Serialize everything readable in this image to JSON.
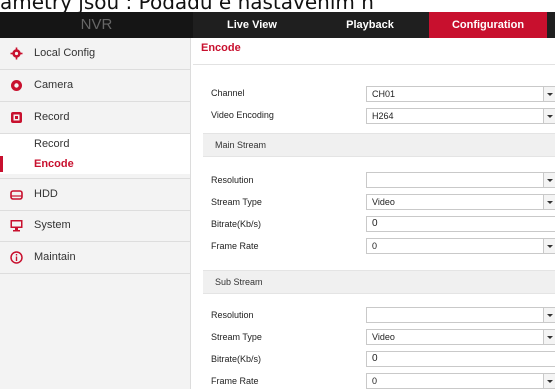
{
  "caption": "ametry jsou : Podadu e nastavenim n",
  "topbar": {
    "brand": "NVR",
    "tabs": [
      "Live View",
      "Playback",
      "Configuration"
    ],
    "active_tab": "Configuration"
  },
  "sidebar": {
    "items": [
      {
        "label": "Local Config",
        "icon": "gear-icon"
      },
      {
        "label": "Camera",
        "icon": "camera-icon"
      },
      {
        "label": "Record",
        "icon": "record-icon"
      },
      {
        "label": "HDD",
        "icon": "hdd-icon"
      },
      {
        "label": "System",
        "icon": "monitor-icon"
      },
      {
        "label": "Maintain",
        "icon": "info-icon"
      }
    ],
    "record_sub": [
      {
        "label": "Record"
      },
      {
        "label": "Encode"
      }
    ]
  },
  "content": {
    "tab": "Encode",
    "channel_label": "Channel",
    "channel_value": "CH01",
    "encoding_label": "Video Encoding",
    "encoding_value": "H264",
    "main": {
      "title": "Main Stream",
      "resolution_label": "Resolution",
      "resolution_value": "",
      "stream_type_label": "Stream Type",
      "stream_type_value": "Video",
      "bitrate_label": "Bitrate(Kb/s)",
      "bitrate_value": "0",
      "frame_rate_label": "Frame Rate",
      "frame_rate_value": "0"
    },
    "sub": {
      "title": "Sub Stream",
      "resolution_label": "Resolution",
      "resolution_value": "",
      "stream_type_label": "Stream Type",
      "stream_type_value": "Video",
      "bitrate_label": "Bitrate(Kb/s)",
      "bitrate_value": "0",
      "frame_rate_label": "Frame Rate",
      "frame_rate_value": "0"
    }
  },
  "colors": {
    "accent": "#c8102e",
    "topbar": "#1f1f1f"
  }
}
